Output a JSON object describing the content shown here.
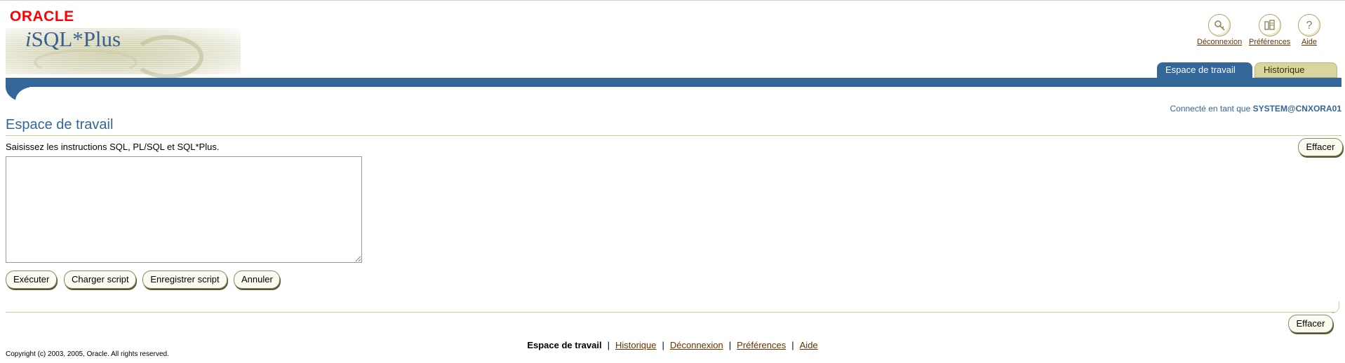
{
  "branding": {
    "oracle_logo": "ORACLE",
    "product_name_i": "i",
    "product_name_rest": "SQL*Plus"
  },
  "global_buttons": [
    {
      "label": "Déconnexion",
      "icon": "logout-icon"
    },
    {
      "label": "Préférences",
      "icon": "preferences-icon"
    },
    {
      "label": "Aide",
      "icon": "help-icon"
    }
  ],
  "tabs": [
    {
      "label": "Espace de travail",
      "active": true
    },
    {
      "label": "Historique",
      "active": false
    }
  ],
  "connection": {
    "prefix": "Connecté en tant que",
    "user": "SYSTEM@CNXORA01"
  },
  "page": {
    "title": "Espace de travail",
    "instructions": "Saisissez les instructions SQL, PL/SQL et SQL*Plus.",
    "clear_label": "Effacer",
    "sql_value": ""
  },
  "actions": {
    "execute": "Exécuter",
    "load_script": "Charger script",
    "save_script": "Enregistrer script",
    "cancel": "Annuler"
  },
  "bottom": {
    "clear_label": "Effacer"
  },
  "footer": {
    "current": "Espace de travail",
    "links": [
      "Historique",
      "Déconnexion",
      "Préférences",
      "Aide"
    ],
    "copyright": "Copyright (c) 2003, 2005, Oracle. All rights reserved."
  },
  "colors": {
    "brand_blue": "#336699",
    "oracle_red": "#ff0000",
    "link_brown": "#663300",
    "rule_tan": "#cccc99"
  }
}
